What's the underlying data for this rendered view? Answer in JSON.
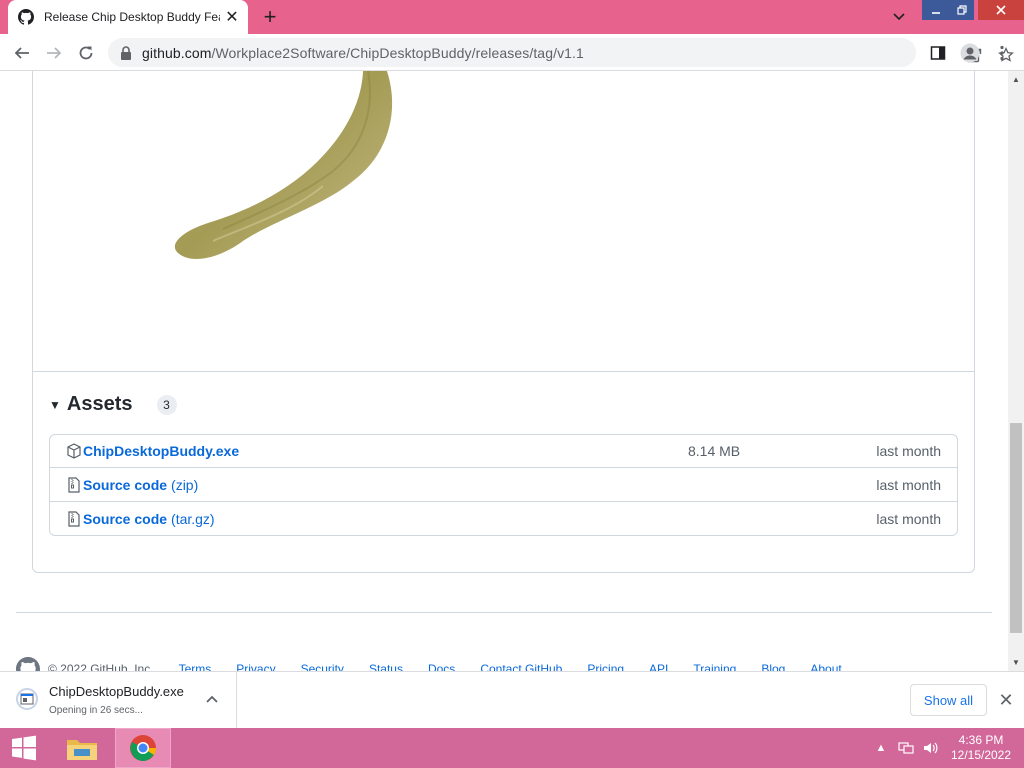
{
  "browser": {
    "tab_title": "Release Chip Desktop Buddy Fea",
    "url_host": "github.com",
    "url_path": "/Workplace2Software/ChipDesktopBuddy/releases/tag/v1.1"
  },
  "colors": {
    "tab_strip": "#e8628e",
    "taskbar": "#d2679a",
    "link": "#0969da"
  },
  "assets": {
    "title": "Assets",
    "count": "3",
    "items": [
      {
        "name": "ChipDesktopBuddy.exe",
        "suffix": "",
        "size": "8.14 MB",
        "date": "last month",
        "icon": "package-icon"
      },
      {
        "name": "Source code",
        "suffix": "(zip)",
        "size": "",
        "date": "last month",
        "icon": "file-zip-icon"
      },
      {
        "name": "Source code",
        "suffix": "(tar.gz)",
        "size": "",
        "date": "last month",
        "icon": "file-zip-icon"
      }
    ]
  },
  "footer": {
    "copyright": "© 2022 GitHub, Inc.",
    "links": [
      "Terms",
      "Privacy",
      "Security",
      "Status",
      "Docs",
      "Contact GitHub",
      "Pricing",
      "API",
      "Training",
      "Blog",
      "About"
    ]
  },
  "download": {
    "filename": "ChipDesktopBuddy.exe",
    "status": "Opening in 26 secs...",
    "show_all": "Show all"
  },
  "clock": {
    "time": "4:36 PM",
    "date": "12/15/2022"
  }
}
